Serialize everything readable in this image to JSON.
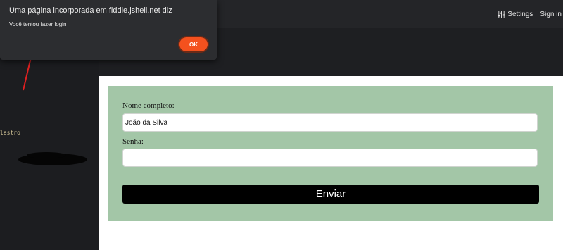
{
  "topbar": {
    "settings_label": "Settings",
    "signin_label": "Sign in",
    "settings_icon": "sliders-icon"
  },
  "editor": {
    "code_text": "lastro"
  },
  "form": {
    "name_label": "Nome completo:",
    "name_value": "João da Silva",
    "password_label": "Senha:",
    "password_value": "",
    "submit_label": "Enviar"
  },
  "alert": {
    "title": "Uma página incorporada em fiddle.jshell.net diz",
    "message": "Você tentou fazer login",
    "ok_label": "OK"
  },
  "colors": {
    "accent": "#f4511e",
    "form_bg": "#a3c6a7",
    "arrow": "#e02020"
  }
}
